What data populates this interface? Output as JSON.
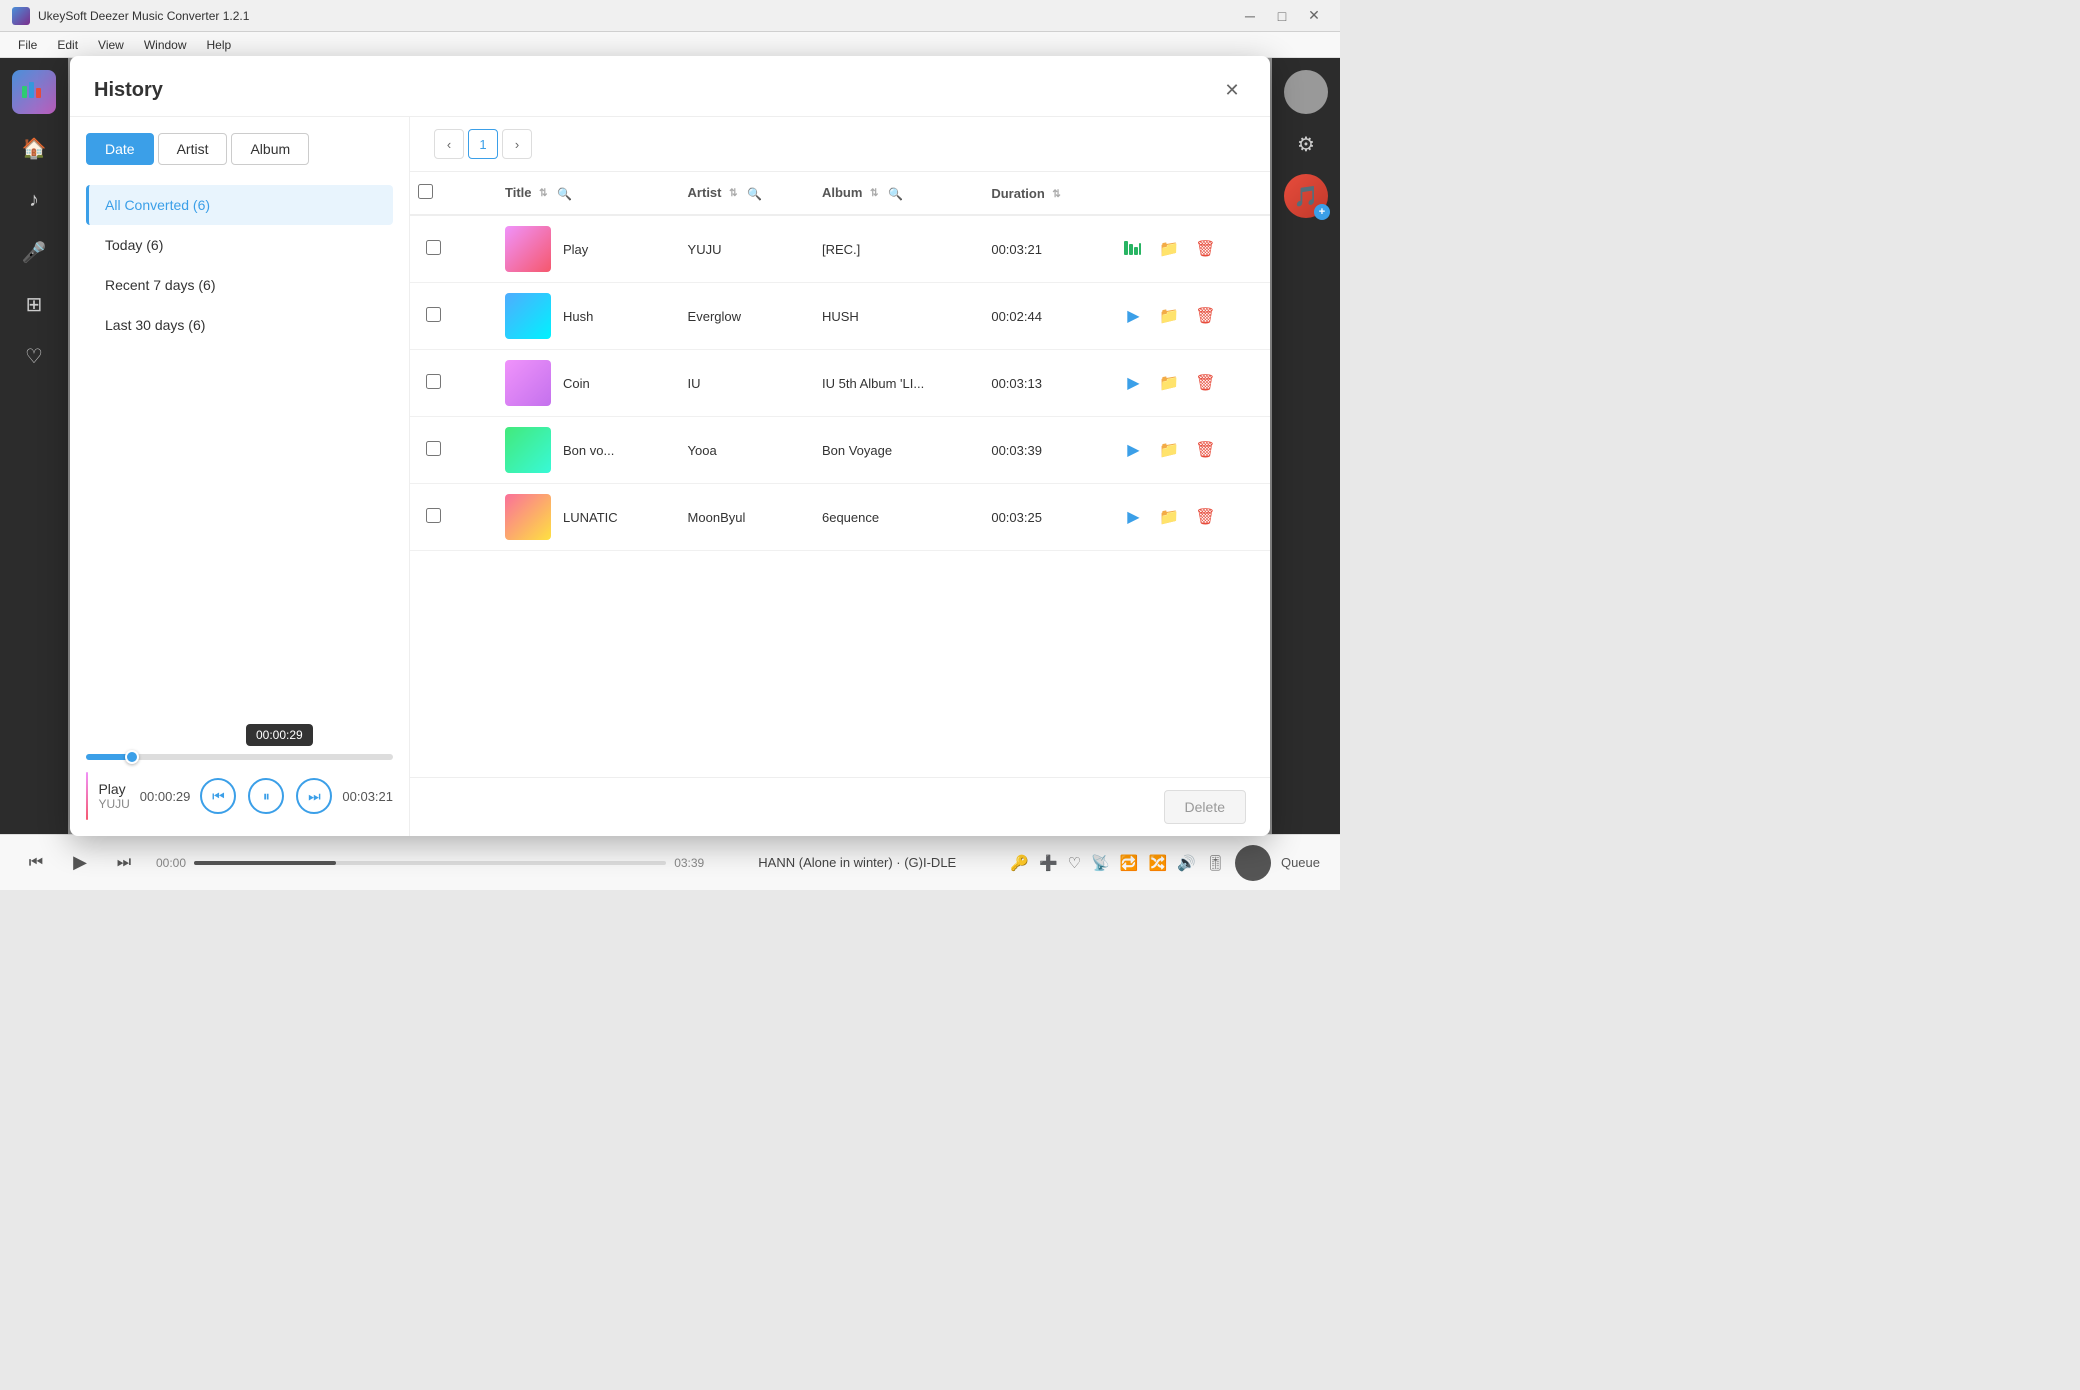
{
  "app": {
    "title": "UkeySoft Deezer Music Converter 1.2.1"
  },
  "titlebar": {
    "minimize": "─",
    "maximize": "□",
    "close": "✕"
  },
  "menubar": {
    "items": [
      "File",
      "Edit",
      "View",
      "Window",
      "Help"
    ]
  },
  "modal": {
    "title": "History",
    "close_label": "✕",
    "filter_tabs": [
      {
        "id": "date",
        "label": "Date",
        "active": true
      },
      {
        "id": "artist",
        "label": "Artist",
        "active": false
      },
      {
        "id": "album",
        "label": "Album",
        "active": false
      }
    ],
    "nav_items": [
      {
        "id": "all",
        "label": "All Converted (6)",
        "active": true
      },
      {
        "id": "today",
        "label": "Today (6)",
        "active": false
      },
      {
        "id": "recent7",
        "label": "Recent 7 days (6)",
        "active": false
      },
      {
        "id": "last30",
        "label": "Last 30 days (6)",
        "active": false
      }
    ],
    "pagination": {
      "prev": "‹",
      "next": "›",
      "current_page": "1"
    },
    "table": {
      "columns": [
        {
          "id": "checkbox",
          "label": ""
        },
        {
          "id": "expand",
          "label": ""
        },
        {
          "id": "title",
          "label": "Title"
        },
        {
          "id": "artist",
          "label": "Artist"
        },
        {
          "id": "album",
          "label": "Album"
        },
        {
          "id": "duration",
          "label": "Duration"
        }
      ],
      "rows": [
        {
          "id": 1,
          "title": "Play",
          "artist": "YUJU",
          "album": "[REC.]",
          "duration": "00:03:21",
          "art_class": "art-play",
          "playing": true
        },
        {
          "id": 2,
          "title": "Hush",
          "artist": "Everglow",
          "album": "HUSH",
          "duration": "00:02:44",
          "art_class": "art-hush",
          "playing": false
        },
        {
          "id": 3,
          "title": "Coin",
          "artist": "IU",
          "album": "IU 5th Album 'LI...",
          "duration": "00:03:13",
          "art_class": "art-coin",
          "playing": false
        },
        {
          "id": 4,
          "title": "Bon vo...",
          "artist": "Yooa",
          "album": "Bon Voyage",
          "duration": "00:03:39",
          "art_class": "art-bon",
          "playing": false
        },
        {
          "id": 5,
          "title": "LUNATIC",
          "artist": "MoonByul",
          "album": "6equence",
          "duration": "00:03:25",
          "art_class": "art-lun",
          "playing": false
        }
      ]
    },
    "player": {
      "time_tooltip": "00:00:29",
      "progress_percent": 15,
      "now_playing_title": "Play",
      "now_playing_artist": "YUJU",
      "time_current": "00:00:29",
      "time_total": "00:03:21",
      "btn_prev": "⏮",
      "btn_pause": "⏸",
      "btn_next": "⏭"
    },
    "footer": {
      "delete_label": "Delete"
    }
  },
  "footer_player": {
    "song": "HANN (Alone in winter) · (G)I-DLE",
    "time_left": "00:00",
    "time_right": "03:39",
    "progress_percent": 30,
    "queue_label": "Queue"
  },
  "sidebar": {
    "left_icons": [
      "🏠",
      "♪",
      "🎤",
      "⊞",
      "♡"
    ],
    "right_icons": []
  }
}
